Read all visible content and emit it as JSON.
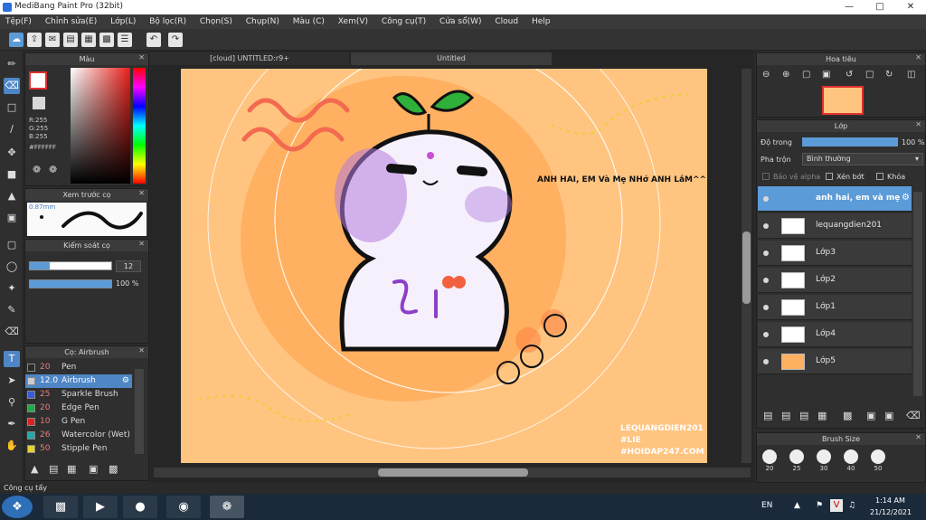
{
  "window": {
    "title": "MediBang Paint Pro (32bit)"
  },
  "menu": [
    "Tệp(F)",
    "Chỉnh sửa(E)",
    "Lớp(L)",
    "Bộ lọc(R)",
    "Chọn(S)",
    "Chụp(N)",
    "Màu (C)",
    "Xem(V)",
    "Công cụ(T)",
    "Cửa sổ(W)",
    "Cloud",
    "Help"
  ],
  "color_panel": {
    "title": "Màu",
    "r": "R:255",
    "g": "G:255",
    "b": "B:255",
    "hex": "#FFFFFF"
  },
  "preview_panel": {
    "title": "Xem trước cọ",
    "size": "0.87mm"
  },
  "brush_control": {
    "title": "Kiểm soát cọ",
    "size_value": "12",
    "opacity_value": "100 %"
  },
  "brush_panel": {
    "title": "Cọ: Airbrush",
    "items": [
      {
        "size": "20",
        "name": "Pen",
        "color": "#2a2a2a"
      },
      {
        "size": "12.0",
        "name": "Airbrush",
        "color": "#cccccc",
        "selected": true
      },
      {
        "size": "25",
        "name": "Sparkle Brush",
        "color": "#3a5bd8"
      },
      {
        "size": "20",
        "name": "Edge Pen",
        "color": "#22aa44"
      },
      {
        "size": "10",
        "name": "G Pen",
        "color": "#dd2222"
      },
      {
        "size": "26",
        "name": "Watercolor (Wet)",
        "color": "#22aaaa"
      },
      {
        "size": "50",
        "name": "Stipple Pen",
        "color": "#e8d22a"
      }
    ]
  },
  "tabs": {
    "cloud": "[cloud] UNTITLED:r9+",
    "untitled": "Untitled"
  },
  "artwork": {
    "bg_color": "#ffc480",
    "text_main": "ANH HAI, EM Và Mẹ NHớ ANH LắM^^",
    "sig_line1": "LEQUANGDIEN201",
    "sig_line2": "#LIE",
    "sig_line3": "#HOIDAP247.COM"
  },
  "navigator": {
    "title": "Hoa tiêu"
  },
  "layers_panel": {
    "title": "Lớp",
    "opacity_label": "Độ trong",
    "opacity_value": "100 %",
    "blend_label": "Pha trộn",
    "blend_value": "Bình thường",
    "protect_alpha": "Bảo vệ alpha",
    "clipping": "Xén bớt",
    "lock": "Khóa",
    "layers": [
      {
        "name": "anh hai, em và mẹ",
        "selected": true
      },
      {
        "name": "lequangdien201"
      },
      {
        "name": "Lớp3"
      },
      {
        "name": "Lớp2"
      },
      {
        "name": "Lớp1"
      },
      {
        "name": "Lớp4"
      },
      {
        "name": "Lớp5"
      }
    ]
  },
  "brush_size_panel": {
    "title": "Brush Size",
    "sizes": [
      "20",
      "25",
      "30",
      "40",
      "50"
    ]
  },
  "status": {
    "text": "Công cụ tẩy"
  },
  "taskbar": {
    "lang": "EN",
    "time": "1:14 AM",
    "date": "21/12/2021"
  }
}
